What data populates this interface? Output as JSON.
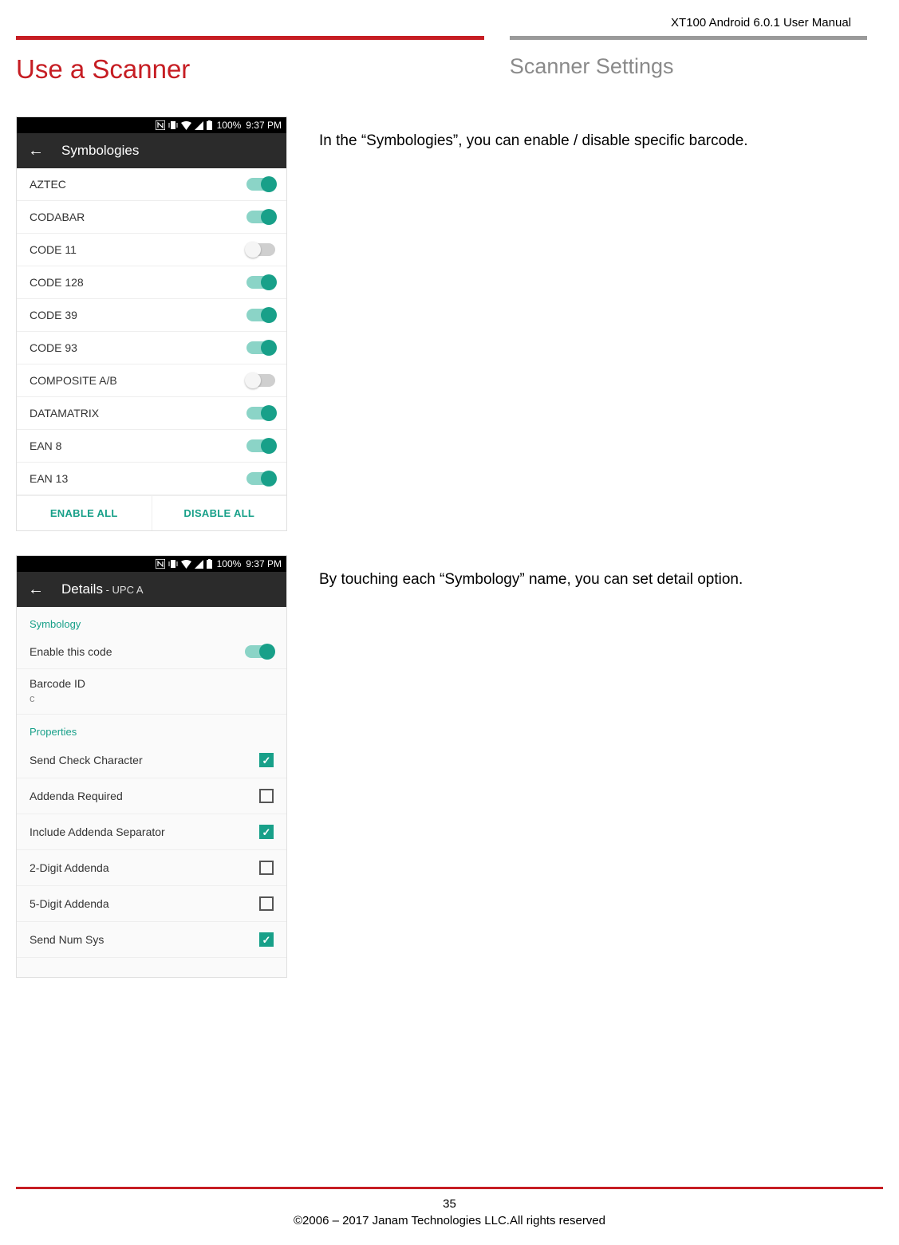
{
  "doc_header": "XT100 Android 6.0.1 User Manual",
  "main_title": "Use a Scanner",
  "sub_title": "Scanner Settings",
  "section1": {
    "body_text": "In the “Symbologies”, you can enable / disable specific barcode.",
    "status_time": "9:37 PM",
    "status_battery": "100%",
    "app_title": "Symbologies",
    "items": [
      {
        "label": "AZTEC",
        "on": true
      },
      {
        "label": "CODABAR",
        "on": true
      },
      {
        "label": "CODE 11",
        "on": false
      },
      {
        "label": "CODE 128",
        "on": true
      },
      {
        "label": "CODE 39",
        "on": true
      },
      {
        "label": "CODE 93",
        "on": true
      },
      {
        "label": "COMPOSITE A/B",
        "on": false
      },
      {
        "label": "DATAMATRIX",
        "on": true
      },
      {
        "label": "EAN 8",
        "on": true
      },
      {
        "label": "EAN 13",
        "on": true
      }
    ],
    "enable_all": "ENABLE ALL",
    "disable_all": "DISABLE ALL"
  },
  "section2": {
    "body_text": "By touching each “Symbology” name, you can set detail option.",
    "status_time": "9:37 PM",
    "status_battery": "100%",
    "app_title_main": "Details",
    "app_title_sub": " - UPC A",
    "label_symbology": "Symbology",
    "enable_this_code": "Enable this code",
    "enable_on": true,
    "barcode_id_label": "Barcode ID",
    "barcode_id_value": "c",
    "label_properties": "Properties",
    "props": [
      {
        "label": "Send Check Character",
        "checked": true
      },
      {
        "label": "Addenda Required",
        "checked": false
      },
      {
        "label": "Include Addenda Separator",
        "checked": true
      },
      {
        "label": "2-Digit Addenda",
        "checked": false
      },
      {
        "label": "5-Digit Addenda",
        "checked": false
      },
      {
        "label": "Send Num Sys",
        "checked": true
      }
    ]
  },
  "footer": {
    "page_number": "35",
    "copyright": "©2006 – 2017 Janam Technologies LLC.All rights reserved"
  }
}
